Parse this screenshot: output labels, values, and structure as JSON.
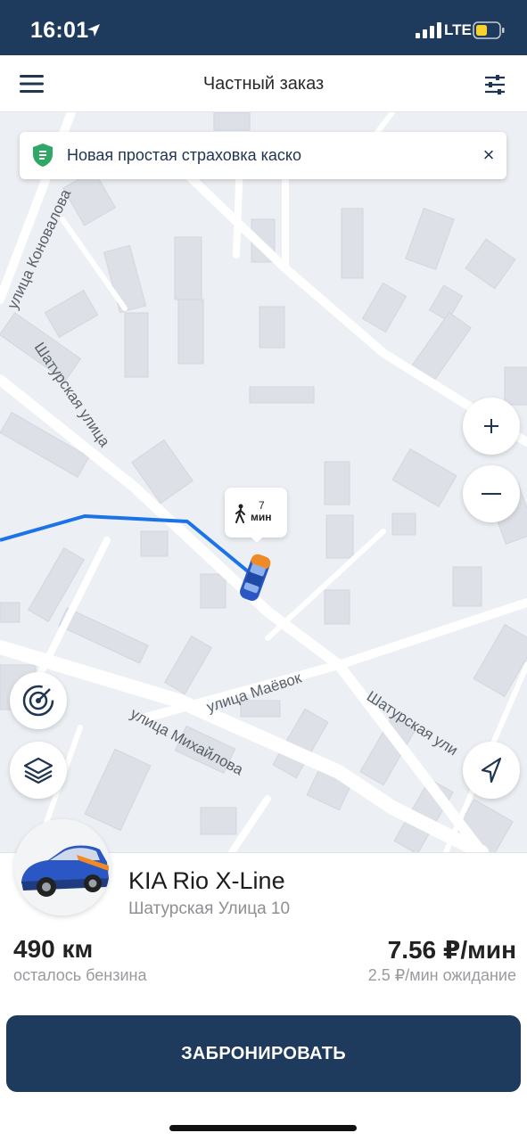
{
  "status_bar": {
    "time": "16:01",
    "network": "LTE"
  },
  "header": {
    "title": "Частный заказ"
  },
  "banner": {
    "text": "Новая простая страховка каско"
  },
  "map": {
    "streets": {
      "konovalova": "улица Коновалова",
      "shaturskaya_1": "Шатурская улица",
      "shaturskaya_2": "Шатурская ули",
      "maevok": "улица Маёвок",
      "mikhailova": "улица Михайлова"
    },
    "walk_time": {
      "value": "7",
      "unit": "мин"
    },
    "colors": {
      "route": "#1a73e8",
      "car_body": "#2a57c4",
      "car_accent": "#f08a24"
    }
  },
  "car": {
    "name": "KIA Rio X-Line",
    "address": "Шатурская Улица 10",
    "range_value": "490 км",
    "range_label": "осталось бензина",
    "price_value": "7.56 ₽/мин",
    "price_wait": "2.5 ₽/мин ожидание"
  },
  "actions": {
    "book_label": "ЗАБРОНИРОВАТЬ"
  },
  "colors": {
    "primary": "#1e3a5c",
    "map_bg": "#eceff3"
  }
}
